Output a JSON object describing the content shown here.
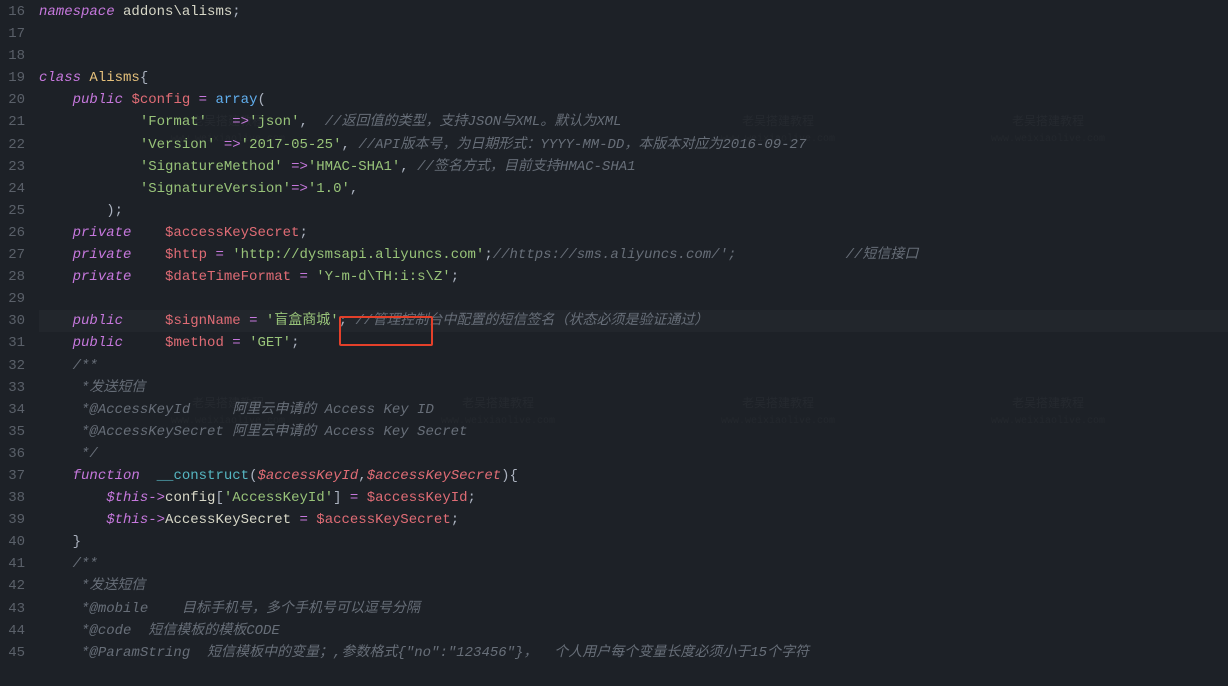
{
  "gutter": {
    "start": 16,
    "end": 45
  },
  "code": {
    "ns_kw": "namespace",
    "ns_name": "addons\\alisms",
    "class_kw": "class",
    "class_name": "Alisms",
    "public_kw": "public",
    "private_kw": "private",
    "function_kw": "function",
    "config_var": "$config",
    "array_fn": "array",
    "cfg_format_k": "'Format'",
    "cfg_format_v": "'json'",
    "cfg_format_c": "//返回值的类型，支持JSON与XML。默认为XML",
    "cfg_version_k": "'Version'",
    "cfg_version_v": "'2017-05-25'",
    "cfg_version_c": "//API版本号，为日期形式：YYYY-MM-DD，本版本对应为2016-09-27",
    "cfg_sigm_k": "'SignatureMethod'",
    "cfg_sigm_v": "'HMAC-SHA1'",
    "cfg_sigm_c": "//签名方式，目前支持HMAC-SHA1",
    "cfg_sigv_k": "'SignatureVersion'",
    "cfg_sigv_v": "'1.0'",
    "aks_var": "$accessKeySecret",
    "http_var": "$http",
    "http_val": "'http://dysmsapi.aliyuncs.com'",
    "http_c1": "//https://sms.aliyuncs.com/';",
    "http_c2": "//短信接口",
    "dtf_var": "$dateTimeFormat",
    "dtf_val": "'Y-m-d\\TH:i:s\\Z'",
    "sign_var": "$signName",
    "sign_val": "'盲盒商城'",
    "sign_c": "//管理控制台中配置的短信签名（状态必须是验证通过）",
    "method_var": "$method",
    "method_val": "'GET'",
    "doc_open": "/**",
    "doc_send": " *发送短信",
    "doc_akid": " *@AccessKeyId     阿里云申请的 Access Key ID",
    "doc_aks": " *@AccessKeySecret 阿里云申请的 Access Key Secret",
    "doc_close": " */",
    "construct": "__construct",
    "p_akid": "$accessKeyId",
    "p_aks": "$accessKeySecret",
    "this": "$this",
    "cfg_prop": "config",
    "akid_key": "'AccessKeyId'",
    "aks_prop": "AccessKeySecret",
    "doc2_open": "/**",
    "doc2_send": " *发送短信",
    "doc2_mobile": " *@mobile    目标手机号，多个手机号可以逗号分隔",
    "doc2_code": " *@code  短信模板的模板CODE",
    "doc2_param": " *@ParamString  短信模板中的变量；,参数格式{\"no\":\"123456\"}，  个人用户每个变量长度必须小于15个字符"
  },
  "watermark": {
    "title": "老吴搭建教程",
    "sub": "www.weixiaolive.com"
  }
}
